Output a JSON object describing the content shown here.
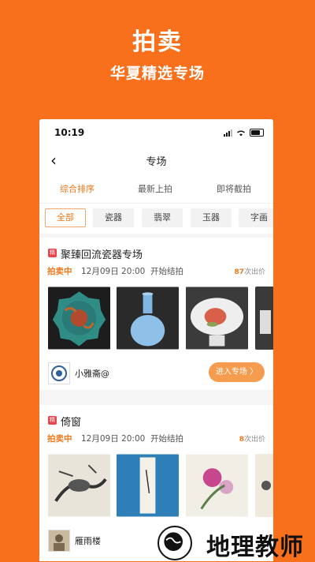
{
  "hero": {
    "title": "拍卖",
    "subtitle": "华夏精选专场"
  },
  "statusbar": {
    "time": "10:19"
  },
  "navbar": {
    "title": "专场"
  },
  "sort_tabs": [
    "综合排序",
    "最新上拍",
    "即将截拍"
  ],
  "filters": [
    "全部",
    "瓷器",
    "翡翠",
    "玉器",
    "字画"
  ],
  "cards": [
    {
      "tag": "精",
      "title": "聚臻回流瓷器专场",
      "status": "拍卖中",
      "date": "12月09日 20:00",
      "start_label": "开始结拍",
      "bid_count": "87",
      "bid_suffix": "次出价",
      "shop": "小雅斋@",
      "enter_label": "进入专场 〉"
    },
    {
      "tag": "精",
      "title": "倚窗",
      "status": "拍卖中",
      "date": "12月09日 20:00",
      "start_label": "开始结拍",
      "bid_count": "8",
      "bid_suffix": "次出价",
      "shop": "雁雨楼"
    }
  ],
  "watermark": {
    "text": "地理教师"
  },
  "colors": {
    "brand_orange": "#f8701c",
    "accent": "#f3771b",
    "tag_red": "#e9424b"
  }
}
